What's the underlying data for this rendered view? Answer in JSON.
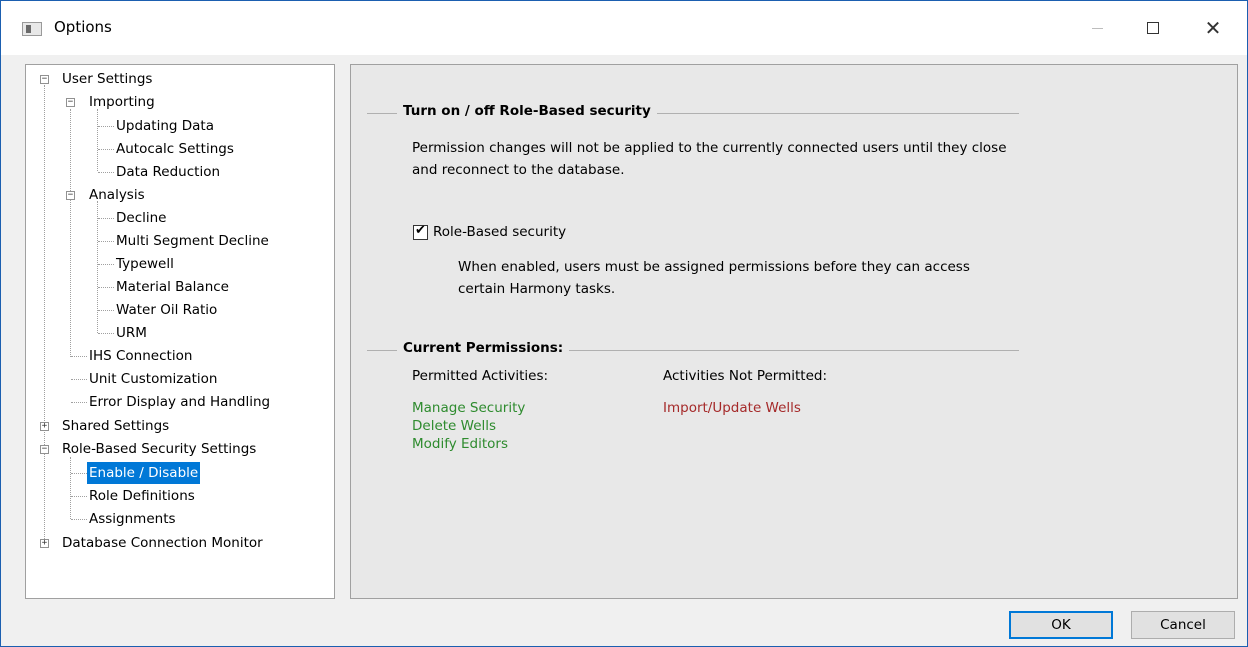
{
  "window": {
    "title": "Options",
    "minimize_icon": "minimize-icon",
    "maximize_icon": "maximize-icon",
    "close_icon": "close-icon"
  },
  "tree": {
    "items": [
      {
        "label": "User Settings",
        "expander": "−"
      },
      {
        "label": "Importing",
        "expander": "−"
      },
      {
        "label": "Updating Data"
      },
      {
        "label": "Autocalc Settings"
      },
      {
        "label": "Data Reduction"
      },
      {
        "label": "Analysis",
        "expander": "−"
      },
      {
        "label": "Decline"
      },
      {
        "label": "Multi Segment Decline"
      },
      {
        "label": "Typewell"
      },
      {
        "label": "Material Balance"
      },
      {
        "label": "Water Oil Ratio"
      },
      {
        "label": "URM"
      },
      {
        "label": "IHS Connection"
      },
      {
        "label": "Unit Customization"
      },
      {
        "label": "Error Display and Handling"
      },
      {
        "label": "Shared Settings",
        "expander": "+"
      },
      {
        "label": "Role-Based Security Settings",
        "expander": "−"
      },
      {
        "label": "Enable / Disable",
        "selected": true
      },
      {
        "label": "Role Definitions"
      },
      {
        "label": "Assignments"
      },
      {
        "label": "Database Connection Monitor",
        "expander": "+"
      }
    ]
  },
  "security_group": {
    "title": "Turn on / off Role-Based security",
    "notice_line1": "Permission changes will not be applied to the currently connected users until they close",
    "notice_line2": "and reconnect to the database.",
    "checkbox_label": "Role-Based security",
    "checkbox_checked": true,
    "desc_line1": "When enabled, users must be assigned permissions before they can access",
    "desc_line2": "certain Harmony tasks."
  },
  "permissions_group": {
    "title": "Current Permissions:",
    "permitted_header": "Permitted Activities:",
    "permitted": [
      "Manage Security",
      "Delete Wells",
      "Modify Editors"
    ],
    "not_permitted_header": "Activities Not Permitted:",
    "not_permitted": [
      "Import/Update Wells"
    ],
    "permitted_color": "#2e8b2e",
    "not_permitted_color": "#a52a2a"
  },
  "buttons": {
    "ok": "OK",
    "cancel": "Cancel"
  }
}
